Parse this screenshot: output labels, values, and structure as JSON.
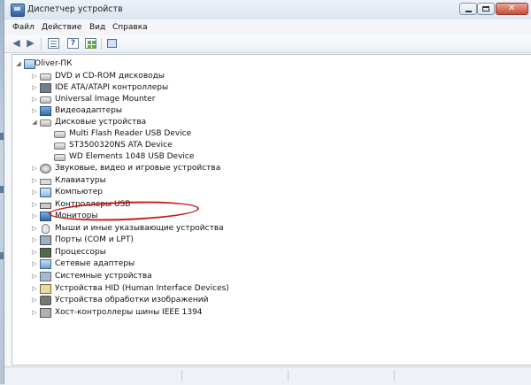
{
  "window": {
    "title": "Диспетчер устройств"
  },
  "menu": [
    "Файл",
    "Действие",
    "Вид",
    "Справка"
  ],
  "toolbar": {
    "buttons": [
      {
        "name": "back-button",
        "icon": "arrow-left-icon"
      },
      {
        "name": "forward-button",
        "icon": "arrow-right-icon"
      },
      {
        "name": "properties-button",
        "icon": "properties-icon"
      },
      {
        "name": "help-button",
        "icon": "help-icon"
      },
      {
        "name": "view-button",
        "icon": "view-icon"
      },
      {
        "name": "scan-hardware-button",
        "icon": "scan-hardware-icon"
      }
    ]
  },
  "tree": {
    "root": "Oliver-ПК",
    "nodes": [
      {
        "label": "DVD и CD-ROM дисководы",
        "icon": "dvd-drive-icon",
        "expanded": false
      },
      {
        "label": "IDE ATA/ATAPI контроллеры",
        "icon": "ide-controller-icon",
        "expanded": false
      },
      {
        "label": "Universal Image Mounter",
        "icon": "image-mounter-icon",
        "expanded": false
      },
      {
        "label": "Видеоадаптеры",
        "icon": "display-adapter-icon",
        "expanded": false
      },
      {
        "label": "Дисковые устройства",
        "icon": "disk-drive-icon",
        "expanded": true,
        "children": [
          "Multi Flash Reader USB Device",
          "ST3500320NS ATA Device",
          "WD Elements 1048 USB Device"
        ]
      },
      {
        "label": "Звуковые, видео и игровые устройства",
        "icon": "sound-device-icon",
        "expanded": false
      },
      {
        "label": "Клавиатуры",
        "icon": "keyboard-icon",
        "expanded": false
      },
      {
        "label": "Компьютер",
        "icon": "computer-icon",
        "expanded": false
      },
      {
        "label": "Контроллеры USB",
        "icon": "usb-controller-icon",
        "expanded": false
      },
      {
        "label": "Мониторы",
        "icon": "monitor-icon",
        "expanded": false
      },
      {
        "label": "Мыши и иные указывающие устройства",
        "icon": "mouse-icon",
        "expanded": false
      },
      {
        "label": "Порты (COM и LPT)",
        "icon": "port-icon",
        "expanded": false
      },
      {
        "label": "Процессоры",
        "icon": "processor-icon",
        "expanded": false
      },
      {
        "label": "Сетевые адаптеры",
        "icon": "network-adapter-icon",
        "expanded": false
      },
      {
        "label": "Системные устройства",
        "icon": "system-device-icon",
        "expanded": false
      },
      {
        "label": "Устройства HID (Human Interface Devices)",
        "icon": "hid-icon",
        "expanded": false
      },
      {
        "label": "Устройства обработки изображений",
        "icon": "imaging-device-icon",
        "expanded": false
      },
      {
        "label": "Хост-контроллеры шины IEEE 1394",
        "icon": "ieee1394-icon",
        "expanded": false
      }
    ]
  },
  "annotation": {
    "color": "#c81e1e",
    "target": "WD Elements 1048 USB Device"
  }
}
